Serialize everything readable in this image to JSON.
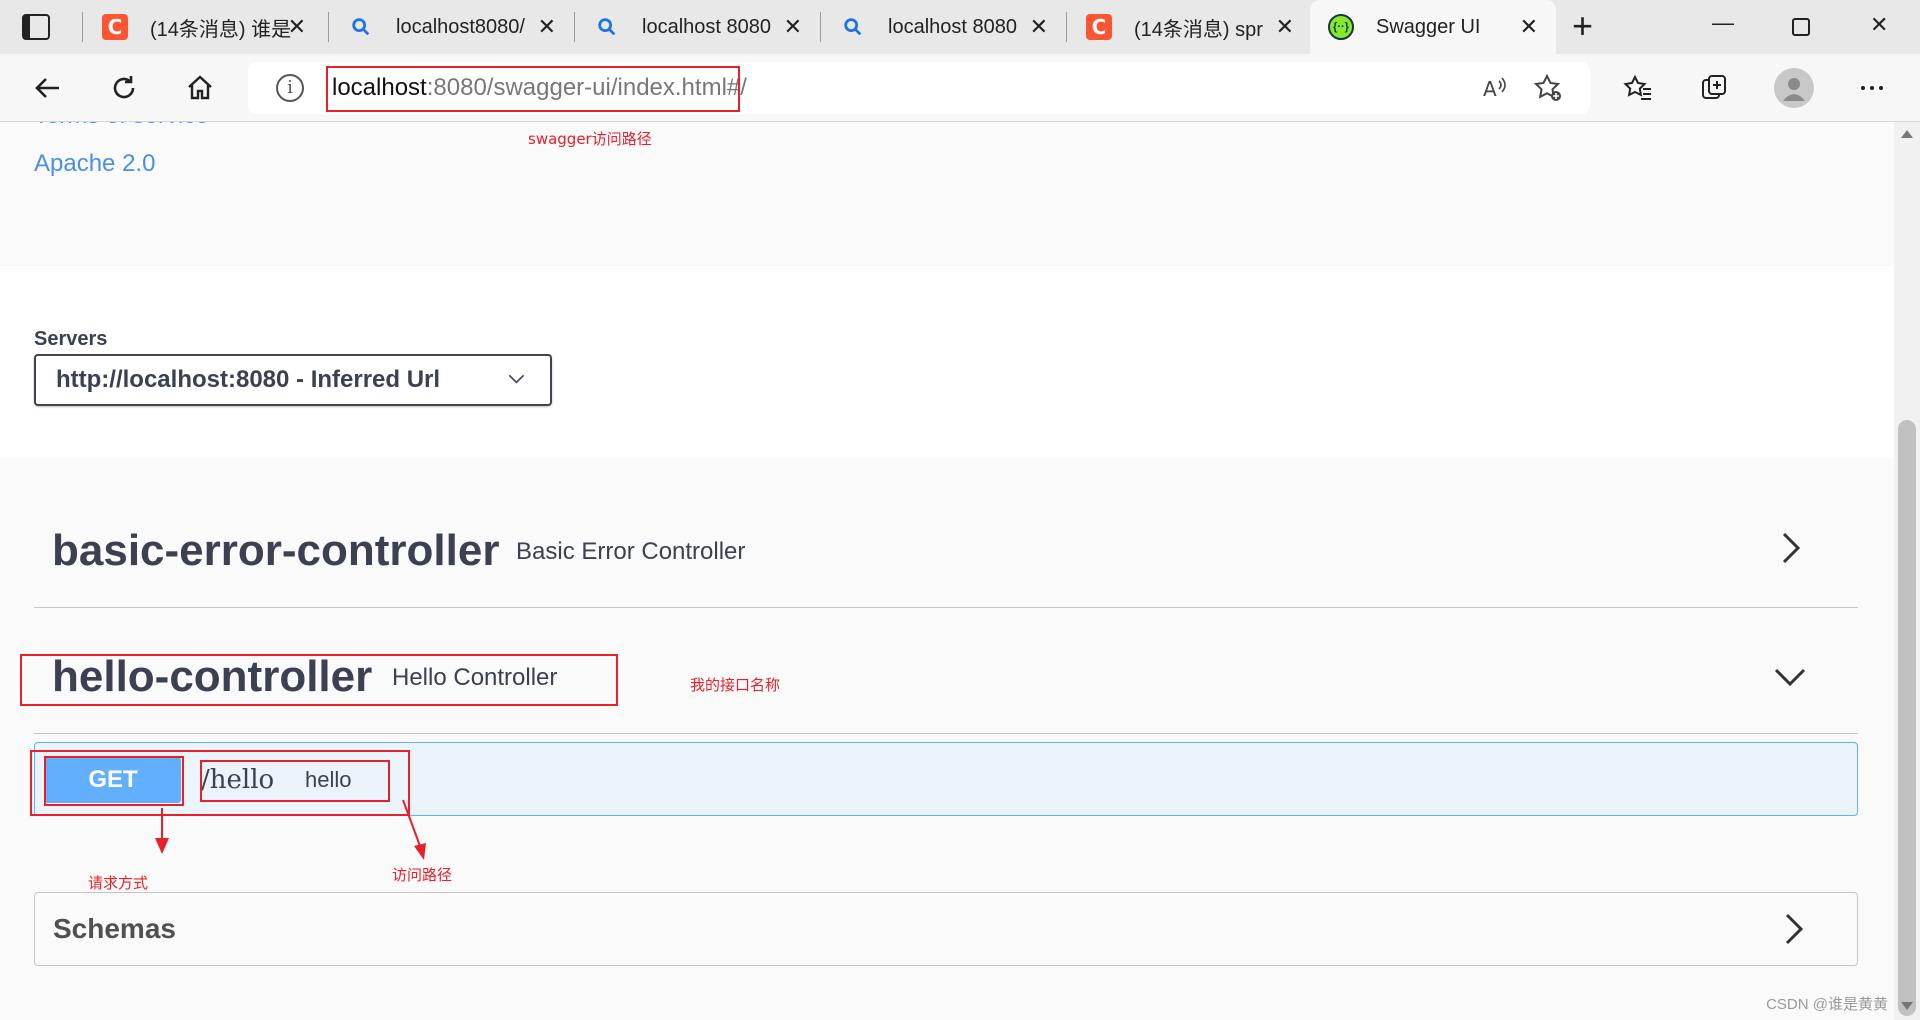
{
  "browser": {
    "tabs": [
      {
        "icon": "csdn-icon",
        "label": "(14条消息) 谁是",
        "active": false
      },
      {
        "icon": "search-icon",
        "label": "localhost8080/",
        "active": false
      },
      {
        "icon": "search-icon",
        "label": "localhost 8080",
        "active": false
      },
      {
        "icon": "search-icon",
        "label": "localhost 8080",
        "active": false
      },
      {
        "icon": "csdn-icon",
        "label": "(14条消息) spr",
        "active": false
      },
      {
        "icon": "swagger-icon",
        "label": "Swagger UI",
        "active": true
      }
    ],
    "url_host": "localhost",
    "url_rest": ":8080/swagger-ui/index.html#/"
  },
  "info": {
    "terms_link": "Terms of service",
    "license_link": "Apache 2.0"
  },
  "servers": {
    "label": "Servers",
    "selected": "http://localhost:8080 - Inferred Url"
  },
  "tags": [
    {
      "name": "basic-error-controller",
      "description": "Basic Error Controller",
      "expanded": false
    },
    {
      "name": "hello-controller",
      "description": "Hello Controller",
      "expanded": true
    }
  ],
  "operation": {
    "method": "GET",
    "path": "/hello",
    "summary": "hello"
  },
  "schemas": {
    "label": "Schemas"
  },
  "annotations": {
    "url_note": "swagger访问路径",
    "controller_note": "我的接口名称",
    "method_note": "请求方式",
    "path_note": "访问路径"
  },
  "watermark": "CSDN @谁是黄黄",
  "colors": {
    "get_method": "#61affe",
    "link": "#4990e2",
    "annotation": "#e8202a"
  }
}
